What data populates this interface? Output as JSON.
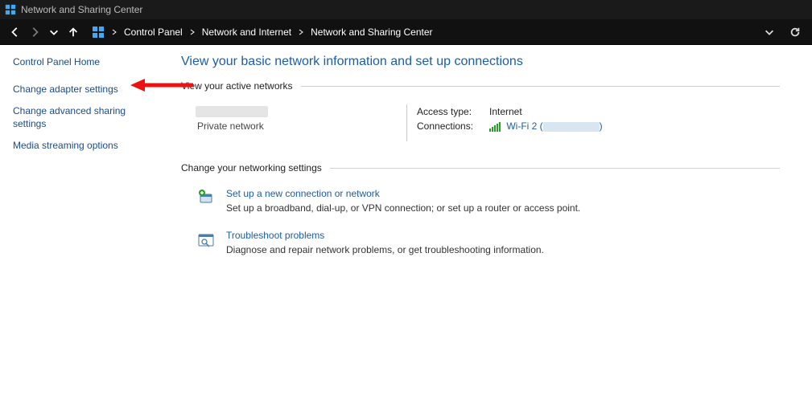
{
  "window": {
    "title": "Network and Sharing Center"
  },
  "breadcrumb": {
    "items": [
      "Control Panel",
      "Network and Internet",
      "Network and Sharing Center"
    ]
  },
  "sidebar": {
    "home": "Control Panel Home",
    "links": [
      "Change adapter settings",
      "Change advanced sharing settings",
      "Media streaming options"
    ]
  },
  "main": {
    "title": "View your basic network information and set up connections",
    "active_header": "View your active networks",
    "network": {
      "type": "Private network",
      "access_label": "Access type:",
      "access_value": "Internet",
      "conn_label": "Connections:",
      "conn_value_prefix": "Wi-Fi 2 (",
      "conn_value_suffix": ")"
    },
    "settings_header": "Change your networking settings",
    "items": [
      {
        "title": "Set up a new connection or network",
        "desc": "Set up a broadband, dial-up, or VPN connection; or set up a router or access point."
      },
      {
        "title": "Troubleshoot problems",
        "desc": "Diagnose and repair network problems, or get troubleshooting information."
      }
    ]
  }
}
